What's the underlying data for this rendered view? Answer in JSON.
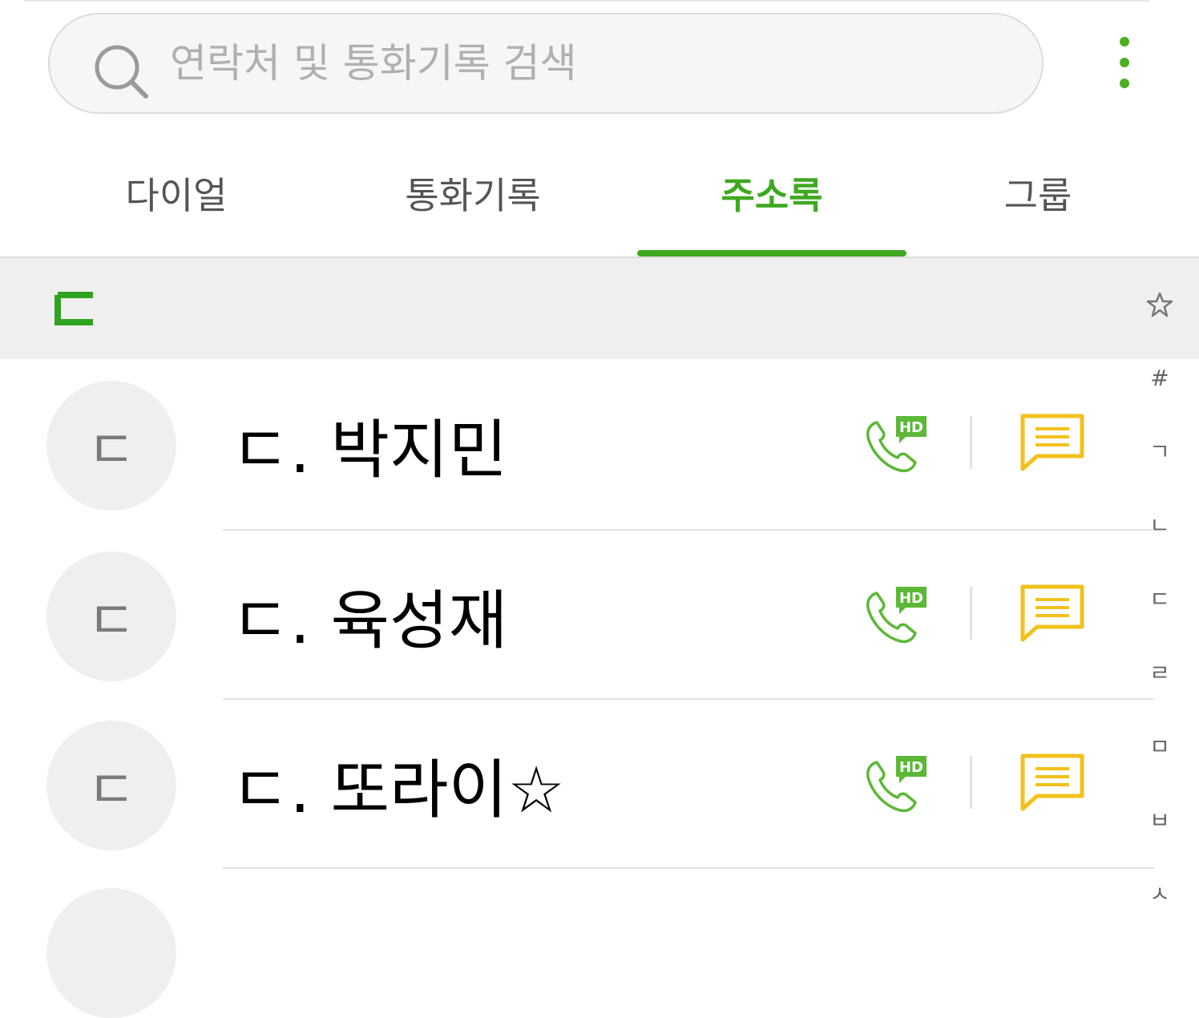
{
  "search": {
    "placeholder": "연락처 및 통화기록 검색"
  },
  "tabs": [
    {
      "label": "다이얼"
    },
    {
      "label": "통화기록"
    },
    {
      "label": "주소록",
      "active": true
    },
    {
      "label": "그룹"
    }
  ],
  "section": {
    "letter": "ㄷ"
  },
  "index_bar": {
    "favorites_icon": "star-outline-icon",
    "items": [
      "#",
      "ㄱ",
      "ㄴ",
      "ㄷ",
      "ㄹ",
      "ㅁ",
      "ㅂ",
      "ㅅ"
    ]
  },
  "contacts": [
    {
      "initial": "ㄷ",
      "name": "ㄷ. 박지민"
    },
    {
      "initial": "ㄷ",
      "name": "ㄷ. 육성재"
    },
    {
      "initial": "ㄷ",
      "name": "ㄷ. 또라이☆"
    }
  ],
  "icons": {
    "call": "hd-call-icon",
    "message": "message-icon"
  },
  "colors": {
    "accent": "#3fa820",
    "message": "#f2c11c",
    "call": "#5cb836"
  }
}
